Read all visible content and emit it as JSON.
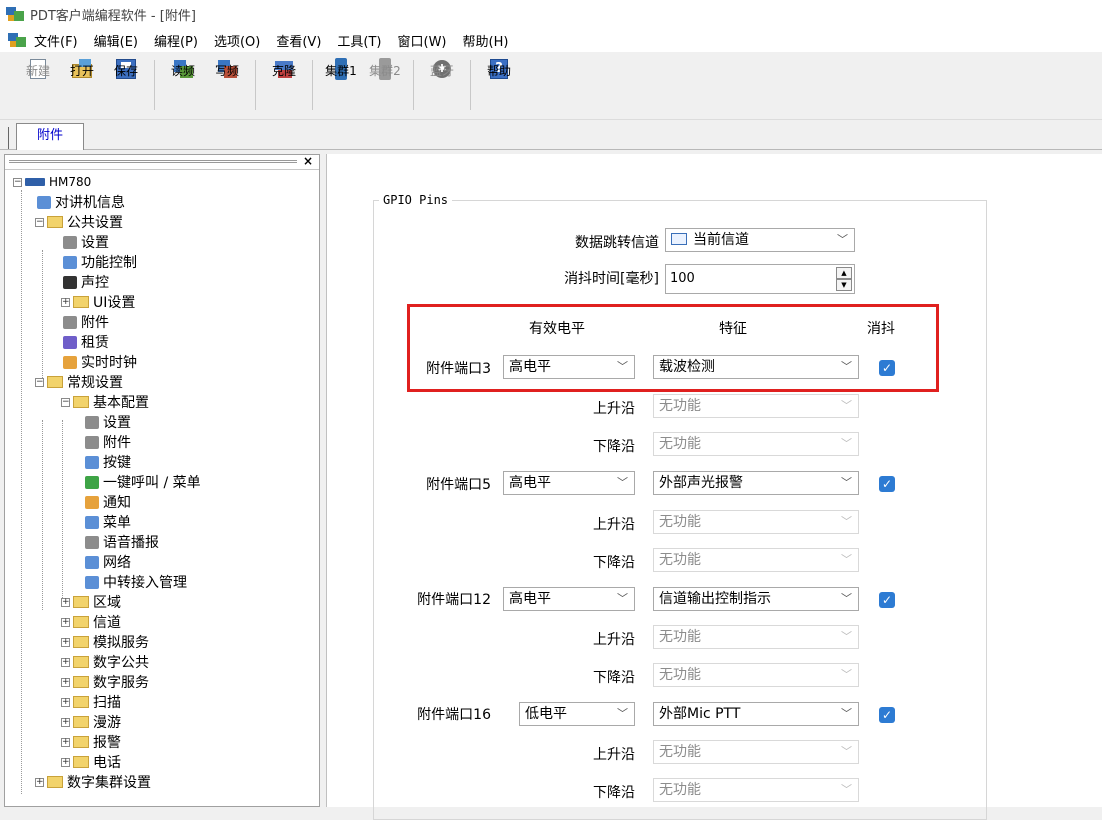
{
  "window": {
    "title": "PDT客户端编程软件 - [附件]"
  },
  "menu": [
    "文件(F)",
    "编辑(E)",
    "编程(P)",
    "选项(O)",
    "查看(V)",
    "工具(T)",
    "窗口(W)",
    "帮助(H)"
  ],
  "toolbar": {
    "new": "新建",
    "open": "打开",
    "save": "保存",
    "read": "读频",
    "write": "写频",
    "clone": "克隆",
    "cluster1": "集群1",
    "cluster2": "集群2",
    "bluetooth": "蓝牙",
    "help": "帮助"
  },
  "tab": {
    "label": "附件"
  },
  "sidebar": {
    "close": "×",
    "tree": [
      "HM780",
      "对讲机信息",
      "公共设置",
      "设置",
      "功能控制",
      "声控",
      "UI设置",
      "附件",
      "租赁",
      "实时时钟",
      "常规设置",
      "基本配置",
      "设置",
      "附件",
      "按键",
      "一键呼叫 / 菜单",
      "通知",
      "菜单",
      "语音播报",
      "网络",
      "中转接入管理",
      "区域",
      "信道",
      "模拟服务",
      "数字公共",
      "数字服务",
      "扫描",
      "漫游",
      "报警",
      "电话",
      "数字集群设置"
    ]
  },
  "content": {
    "group_title": "GPIO Pins",
    "data_jump_label": "数据跳转信道",
    "data_jump_value": "当前信道",
    "debounce_time_label": "消抖时间[毫秒]",
    "debounce_time_value": "100",
    "headers": {
      "level": "有效电平",
      "feature": "特征",
      "debounce": "消抖"
    },
    "rising": "上升沿",
    "falling": "下降沿",
    "none": "无功能",
    "ports": [
      {
        "name": "附件端口3",
        "level": "高电平",
        "feature": "载波检测"
      },
      {
        "name": "附件端口5",
        "level": "高电平",
        "feature": "外部声光报警"
      },
      {
        "name": "附件端口12",
        "level": "高电平",
        "feature": "信道输出控制指示"
      },
      {
        "name": "附件端口16",
        "level": "低电平",
        "feature": "外部Mic PTT"
      }
    ]
  }
}
